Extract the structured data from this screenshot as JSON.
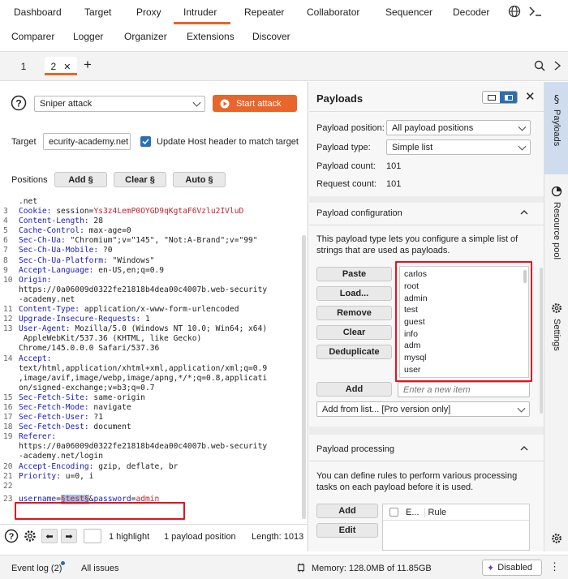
{
  "nav": {
    "row1": [
      "Dashboard",
      "Target",
      "Proxy",
      "Intruder",
      "Repeater",
      "Collaborator",
      "Sequencer",
      "Decoder"
    ],
    "row2": [
      "Comparer",
      "Logger",
      "Organizer",
      "Extensions",
      "Discover"
    ],
    "active": "Intruder"
  },
  "tabs": {
    "items": [
      "1",
      "2"
    ],
    "active": "2",
    "add": "+"
  },
  "attack": {
    "mode": "Sniper attack",
    "start_label": "Start attack"
  },
  "target": {
    "label": "Target",
    "value": "ecurity-academy.net",
    "update_host_label": "Update Host header to match target",
    "update_host_checked": true
  },
  "positions": {
    "label": "Positions",
    "add": "Add §",
    "clear": "Clear §",
    "auto": "Auto §"
  },
  "request": {
    "partial_first": ".net",
    "lines": [
      {
        "n": "3",
        "k": "Cookie: ",
        "v": "session=",
        "r": "Ys3z4LemP0OYGD9qKgtaF6Vzlu2IVluD"
      },
      {
        "n": "4",
        "k": "Content-Length: ",
        "v": "28",
        "r": ""
      },
      {
        "n": "5",
        "k": "Cache-Control: ",
        "v": "max-age=0",
        "r": ""
      },
      {
        "n": "6",
        "k": "Sec-Ch-Ua: ",
        "v": "\"Chromium\";v=\"145\", \"Not:A-Brand\";v=\"99\"",
        "r": ""
      },
      {
        "n": "7",
        "k": "Sec-Ch-Ua-Mobile: ",
        "v": "?0",
        "r": ""
      },
      {
        "n": "8",
        "k": "Sec-Ch-Ua-Platform: ",
        "v": "\"Windows\"",
        "r": ""
      },
      {
        "n": "9",
        "k": "Accept-Language: ",
        "v": "en-US,en;q=0.9",
        "r": ""
      },
      {
        "n": "10",
        "k": "Origin: ",
        "v": "",
        "r": ""
      },
      {
        "n": "",
        "k": "",
        "v": "https://0a06009d0322fe21818b4dea00c4007b.web-security",
        "r": ""
      },
      {
        "n": "",
        "k": "",
        "v": "-academy.net",
        "r": ""
      },
      {
        "n": "11",
        "k": "Content-Type: ",
        "v": "application/x-www-form-urlencoded",
        "r": ""
      },
      {
        "n": "12",
        "k": "Upgrade-Insecure-Requests: ",
        "v": "1",
        "r": ""
      },
      {
        "n": "13",
        "k": "User-Agent: ",
        "v": "Mozilla/5.0 (Windows NT 10.0; Win64; x64)",
        "r": ""
      },
      {
        "n": "",
        "k": "",
        "v": " AppleWebKit/537.36 (KHTML, like Gecko)",
        "r": ""
      },
      {
        "n": "",
        "k": "",
        "v": "Chrome/145.0.0.0 Safari/537.36",
        "r": ""
      },
      {
        "n": "14",
        "k": "Accept: ",
        "v": "",
        "r": ""
      },
      {
        "n": "",
        "k": "",
        "v": "text/html,application/xhtml+xml,application/xml;q=0.9",
        "r": ""
      },
      {
        "n": "",
        "k": "",
        "v": ",image/avif,image/webp,image/apng,*/*;q=0.8,applicati",
        "r": ""
      },
      {
        "n": "",
        "k": "",
        "v": "on/signed-exchange;v=b3;q=0.7",
        "r": ""
      },
      {
        "n": "15",
        "k": "Sec-Fetch-Site: ",
        "v": "same-origin",
        "r": ""
      },
      {
        "n": "16",
        "k": "Sec-Fetch-Mode: ",
        "v": "navigate",
        "r": ""
      },
      {
        "n": "17",
        "k": "Sec-Fetch-User: ",
        "v": "?1",
        "r": ""
      },
      {
        "n": "18",
        "k": "Sec-Fetch-Dest: ",
        "v": "document",
        "r": ""
      },
      {
        "n": "19",
        "k": "Referer: ",
        "v": "",
        "r": ""
      },
      {
        "n": "",
        "k": "",
        "v": "https://0a06009d0322fe21818b4dea00c4007b.web-security",
        "r": ""
      },
      {
        "n": "",
        "k": "",
        "v": "-academy.net/login",
        "r": ""
      },
      {
        "n": "20",
        "k": "Accept-Encoding: ",
        "v": "gzip, deflate, br",
        "r": ""
      },
      {
        "n": "21",
        "k": "Priority: ",
        "v": "u=0, i",
        "r": ""
      },
      {
        "n": "22",
        "k": "",
        "v": "",
        "r": ""
      }
    ],
    "body_line": {
      "n": "23",
      "k1": "username",
      "eq1": "=",
      "marker": "§test§",
      "amp": "&",
      "k2": "password",
      "eq2": "=",
      "v2": "admin"
    }
  },
  "bottombar": {
    "highlight": "1 highlight",
    "payload_positions": "1 payload position",
    "length": "Length: 1013"
  },
  "payloads": {
    "title": "Payloads",
    "position_label": "Payload position:",
    "position_value": "All payload positions",
    "type_label": "Payload type:",
    "type_value": "Simple list",
    "count_label": "Payload count:",
    "count_value": "101",
    "request_label": "Request count:",
    "request_value": "101",
    "config_title": "Payload configuration",
    "config_desc": "This payload type lets you configure a simple list of strings that are used as payloads.",
    "buttons": [
      "Paste",
      "Load...",
      "Remove",
      "Clear",
      "Deduplicate"
    ],
    "list": [
      "carlos",
      "root",
      "admin",
      "test",
      "guest",
      "info",
      "adm",
      "mysql",
      "user"
    ],
    "add_label": "Add",
    "add_placeholder": "Enter a new item",
    "add_from_list": "Add from list... [Pro version only]",
    "processing_title": "Payload processing",
    "processing_desc": "You can define rules to perform various processing tasks on each payload before it is used.",
    "proc_add": "Add",
    "proc_edit": "Edit",
    "col_e": "E...",
    "col_rule": "Rule"
  },
  "sidebar": {
    "payloads": "Payloads",
    "resource_pool": "Resource pool",
    "settings": "Settings"
  },
  "status": {
    "event_log": "Event log (2)",
    "all_issues": "All issues",
    "memory": "Memory: 128.0MB of 11.85GB",
    "disabled": "Disabled"
  },
  "colors": {
    "accent": "#e8652b",
    "highlight_box": "#e0141e"
  }
}
